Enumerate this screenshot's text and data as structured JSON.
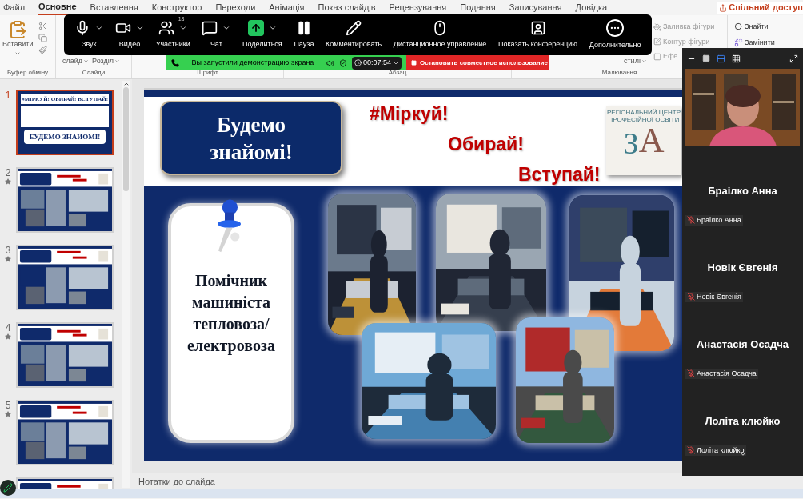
{
  "ribbon": {
    "tabs": [
      {
        "label": "Файл",
        "selected": false
      },
      {
        "label": "Основне",
        "selected": true
      },
      {
        "label": "Вставлення",
        "selected": false
      },
      {
        "label": "Конструктор",
        "selected": false
      },
      {
        "label": "Переходи",
        "selected": false
      },
      {
        "label": "Анімація",
        "selected": false
      },
      {
        "label": "Показ слайдів",
        "selected": false
      },
      {
        "label": "Рецензування",
        "selected": false
      },
      {
        "label": "Подання",
        "selected": false
      },
      {
        "label": "Записування",
        "selected": false
      },
      {
        "label": "Довідка",
        "selected": false
      }
    ],
    "share_button": "Спільний доступ",
    "paste_button": "Вставити",
    "slide_buttons": [
      "слайд",
      "Розділ"
    ],
    "styles_button": "стилі",
    "drawing_buttons": [
      "Заливка фігури",
      "Контур фігури",
      "Ефе"
    ],
    "editing_buttons": [
      "Знайти",
      "Замінити"
    ],
    "group_labels": [
      "Буфер обміну",
      "Слайди",
      "Шрифт",
      "Абзац",
      "Малювання"
    ]
  },
  "meeting_toolbar": {
    "items": [
      {
        "kind": "mic",
        "label": "Звук",
        "caret": true
      },
      {
        "kind": "video",
        "label": "Видео",
        "caret": true
      },
      {
        "kind": "participants",
        "label": "Участники",
        "caret": true,
        "badge": "18"
      },
      {
        "kind": "chat",
        "label": "Чат",
        "caret": true
      },
      {
        "kind": "share",
        "label": "Поделиться",
        "caret": true
      },
      {
        "kind": "pause",
        "label": "Пауза",
        "caret": false
      },
      {
        "kind": "annotate",
        "label": "Комментировать",
        "caret": false
      },
      {
        "kind": "remote",
        "label": "Дистанционное управление",
        "caret": false
      },
      {
        "kind": "view",
        "label": "Показать конференцию",
        "caret": false
      },
      {
        "kind": "more",
        "label": "Дополнительно",
        "caret": false
      }
    ],
    "share_banner": {
      "message": "Вы запустили демонстрацию экрана",
      "timer": "00:07:54",
      "stop_button": "Остановить совместное использование"
    }
  },
  "thumbnails": [
    {
      "number": "1",
      "selected": true,
      "starred": false,
      "title": "#МІРКУЙ! ОБИРАЙ! ВСТУПАЙ!",
      "subtitle": "БУДЕМО ЗНАЙОМІ!"
    },
    {
      "number": "2",
      "selected": false,
      "starred": true
    },
    {
      "number": "3",
      "selected": false,
      "starred": true
    },
    {
      "number": "4",
      "selected": false,
      "starred": true
    },
    {
      "number": "5",
      "selected": false,
      "starred": true
    },
    {
      "selected": false
    }
  ],
  "slide": {
    "heading": "Будемо знайомі!",
    "slogans": [
      "#Міркуй!",
      "Обирай!",
      "Вступай!"
    ],
    "logo": {
      "caption": "РЕГІОНАЛЬНИЙ ЦЕНТР ПРОФЕСІЙНОЇ ОСВІТИ",
      "letters": [
        "З",
        "А"
      ]
    },
    "profession": "Помічник машиніста тепловоза/ електровоза"
  },
  "notes": "Нотатки до слайда",
  "video_panel": {
    "participants": [
      {
        "name": "Браілко Анна",
        "label": "Браілко Анна",
        "muted": true
      },
      {
        "name": "Новік Євгенія",
        "label": "Новік Євгенія",
        "muted": true
      },
      {
        "name": "Анастасія Осадча",
        "label": "Анастасія Осадча",
        "muted": true
      },
      {
        "name": "Лоліта клюйко",
        "label": "Лоліта клюйко",
        "muted": true
      }
    ]
  }
}
